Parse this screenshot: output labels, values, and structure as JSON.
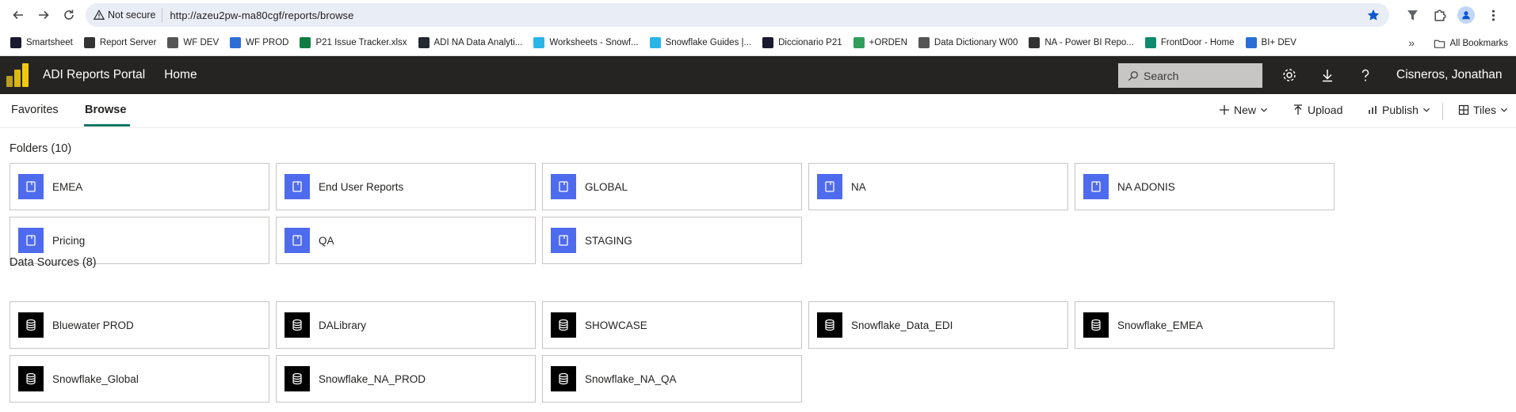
{
  "browser": {
    "not_secure_label": "Not secure",
    "url": "http://azeu2pw-ma80cgf/reports/browse",
    "bookmarks": [
      {
        "label": "Smartsheet",
        "color": "#1a1a2e"
      },
      {
        "label": "Report Server",
        "color": "#333333"
      },
      {
        "label": "WF DEV",
        "color": "#555555"
      },
      {
        "label": "WF PROD",
        "color": "#2b6fd6"
      },
      {
        "label": "P21 Issue Tracker.xlsx",
        "color": "#107c41"
      },
      {
        "label": "ADI NA Data Analyti...",
        "color": "#24292f"
      },
      {
        "label": "Worksheets - Snowf...",
        "color": "#29b5e8"
      },
      {
        "label": "Snowflake Guides |...",
        "color": "#29b5e8"
      },
      {
        "label": "Diccionario P21",
        "color": "#1a1a2e"
      },
      {
        "label": "+ORDEN",
        "color": "#2e9e5b"
      },
      {
        "label": "Data Dictionary W00",
        "color": "#555555"
      },
      {
        "label": "NA - Power BI Repo...",
        "color": "#333333"
      },
      {
        "label": "FrontDoor - Home",
        "color": "#0f8a6d"
      },
      {
        "label": "BI+ DEV",
        "color": "#2b6fd6"
      }
    ],
    "more_label": "»",
    "all_bookmarks_label": "All Bookmarks"
  },
  "app": {
    "title": "ADI Reports Portal",
    "home": "Home",
    "search_placeholder": "Search",
    "user": "Cisneros, Jonathan",
    "brand_color": "#f2c811"
  },
  "toolbar": {
    "tabs": [
      "Favorites",
      "Browse"
    ],
    "new_label": "New",
    "upload_label": "Upload",
    "publish_label": "Publish",
    "tiles_label": "Tiles"
  },
  "folders": {
    "title": "Folders (10)",
    "items": [
      "EMEA",
      "End User Reports",
      "GLOBAL",
      "NA",
      "NA ADONIS",
      "Pricing",
      "QA",
      "STAGING"
    ]
  },
  "data_sources": {
    "title": "Data Sources (8)",
    "items": [
      "Bluewater PROD",
      "DALibrary",
      "SHOWCASE",
      "Snowflake_Data_EDI",
      "Snowflake_EMEA",
      "Snowflake_Global",
      "Snowflake_NA_PROD",
      "Snowflake_NA_QA"
    ]
  }
}
